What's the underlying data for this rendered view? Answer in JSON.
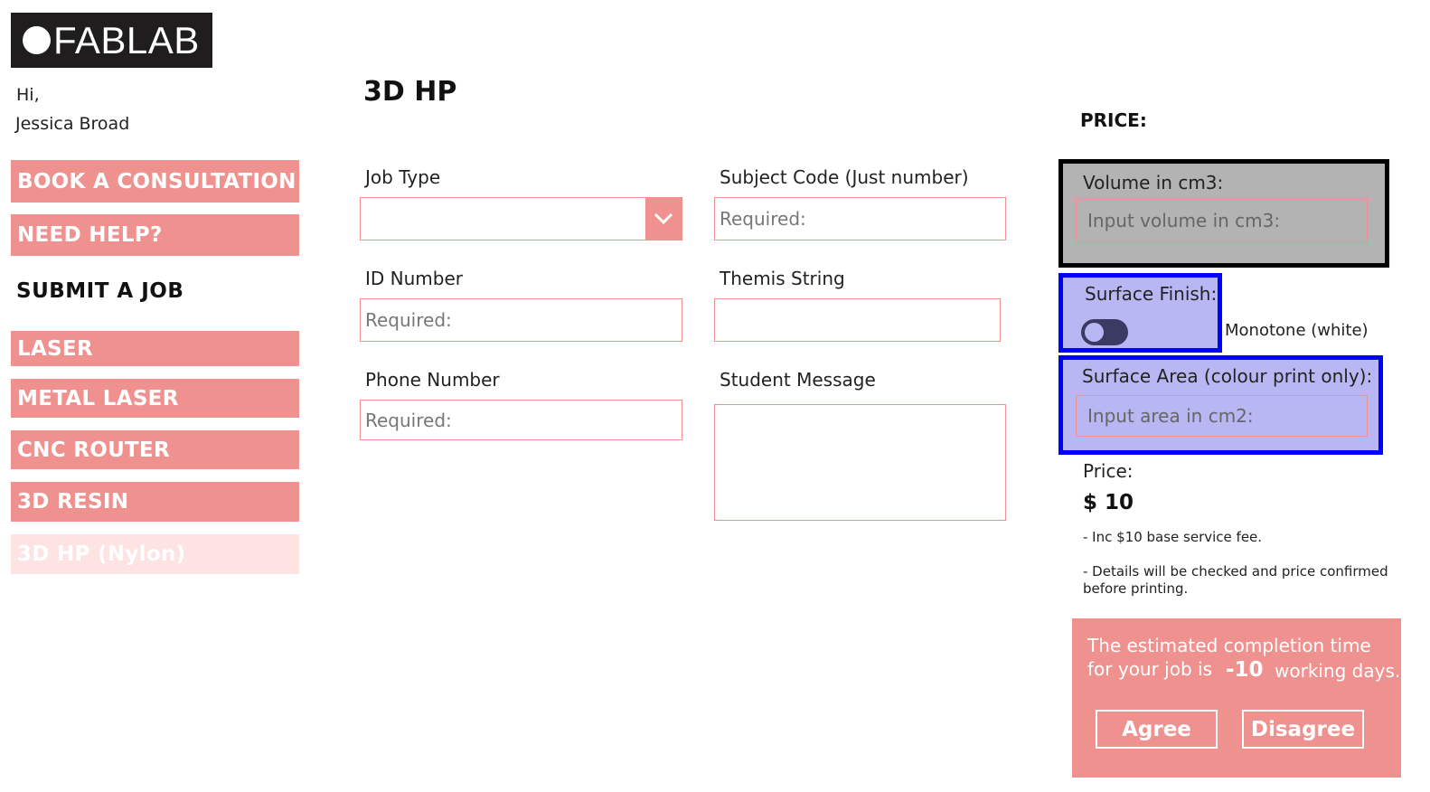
{
  "logo": {
    "text": "FABLAB"
  },
  "user": {
    "greeting": "Hi,",
    "name": "Jessica Broad"
  },
  "sidebar": {
    "book_consultation": "BOOK A CONSULTATION",
    "need_help": "NEED HELP?",
    "submit_heading": "SUBMIT A JOB",
    "items": [
      {
        "label": "LASER"
      },
      {
        "label": "METAL LASER"
      },
      {
        "label": "CNC ROUTER"
      },
      {
        "label": "3D RESIN"
      },
      {
        "label": "3D HP (Nylon)",
        "active": true
      }
    ]
  },
  "page": {
    "title": "3D HP"
  },
  "form": {
    "job_type": {
      "label": "Job Type",
      "value": ""
    },
    "subject_code": {
      "label": "Subject Code (Just number)",
      "placeholder": "Required:"
    },
    "id_number": {
      "label": "ID Number",
      "placeholder": "Required:"
    },
    "themis_string": {
      "label": "Themis String",
      "value": ""
    },
    "phone_number": {
      "label": "Phone Number",
      "placeholder": "Required:"
    },
    "student_message": {
      "label": "Student Message",
      "value": ""
    }
  },
  "pricing": {
    "heading": "PRICE:",
    "volume": {
      "label": "Volume in cm3:",
      "placeholder": "Input volume in cm3:"
    },
    "surface_finish": {
      "label": "Surface Finish:",
      "toggle_on": false,
      "option_label": "Monotone (white)"
    },
    "surface_area": {
      "label": "Surface Area (colour print only):",
      "placeholder": "Input area in cm2:"
    },
    "price_label": "Price:",
    "price_value": "$ 10",
    "note_1": "- Inc $10 base service fee.",
    "note_2a": "- Details will be checked and price confirmed",
    "note_2b": "before printing."
  },
  "estimate": {
    "line1": "The estimated completion time",
    "line2_prefix": "for your job is",
    "days": "-10",
    "line2_suffix": "working days.",
    "agree": "Agree",
    "disagree": "Disagree"
  },
  "colors": {
    "accent": "#ef928f",
    "active_item": "#fde3e2",
    "logo_bg": "#1f1d1d",
    "highlight_blue": "#0000ff",
    "highlight_fill": "#b8b7f3",
    "volume_fill": "#b3b3b3"
  }
}
